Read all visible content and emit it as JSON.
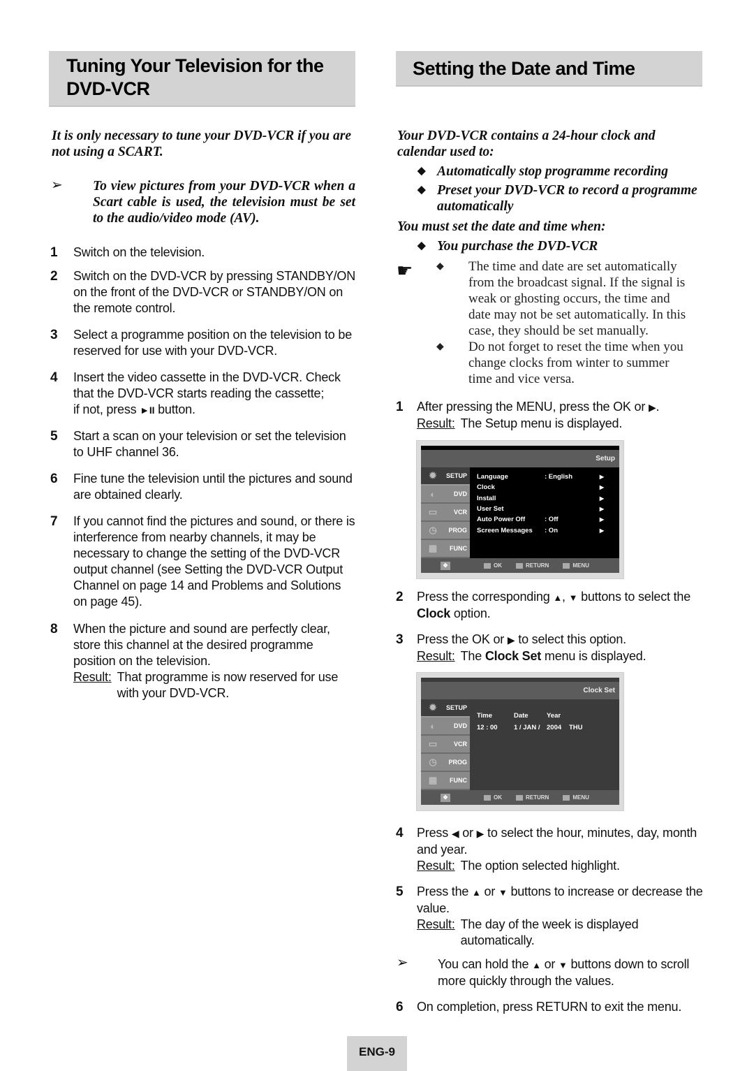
{
  "left": {
    "title_line1": "Tuning Your Television for the",
    "title_line2": "DVD-VCR",
    "intro": "It is only necessary to tune your DVD-VCR if you are not using a SCART.",
    "note_arrow": "➢",
    "note": "To view pictures from your DVD-VCR when a Scart cable is used, the television must be set to the audio/video mode (AV).",
    "steps": [
      {
        "num": "1",
        "text": "Switch on the television."
      },
      {
        "num": "2",
        "text": "Switch on the DVD-VCR by pressing STANDBY/ON on the front of the DVD-VCR or STANDBY/ON on the remote control."
      },
      {
        "num": "3",
        "text": "Select a programme position on the television to be reserved for use with your DVD-VCR."
      },
      {
        "num": "4",
        "text": "Insert the video cassette in the DVD-VCR. Check that the DVD-VCR starts reading the cassette;",
        "text2": "if not, press",
        "icon": "►II",
        "text3": "button."
      },
      {
        "num": "5",
        "text": "Start a scan on your television or set the television to UHF channel 36."
      },
      {
        "num": "6",
        "text": "Fine tune the television until the pictures and sound are obtained clearly."
      },
      {
        "num": "7",
        "text": "If you cannot find the pictures and sound, or there is interference from nearby channels, it may be necessary to change the setting of the DVD-VCR output channel (see Setting the DVD-VCR Output Channel on page 14 and Problems and Solutions on page 45)."
      },
      {
        "num": "8",
        "text": "When the picture and sound are perfectly clear, store this channel at the desired programme position on the television.",
        "result_label": "Result:",
        "result": "That programme is now reserved for use with your DVD-VCR."
      }
    ]
  },
  "right": {
    "title": "Setting the Date and Time",
    "intro": "Your DVD-VCR contains a 24-hour clock and calendar used to:",
    "uses": [
      "Automatically stop programme recording",
      "Preset your DVD-VCR to record a programme automatically"
    ],
    "must_set": "You must set the date and time when:",
    "must_set_items": [
      "You purchase the DVD-VCR"
    ],
    "bullet": "◆",
    "hand_icon": "☛",
    "notes": [
      "The time and date are set automatically from the broadcast signal. If the signal is weak or ghosting occurs, the time and date may not be set automatically. In this case, they should be set manually.",
      "Do not forget to reset the time when you change clocks from winter to summer time and vice versa."
    ],
    "steps": [
      {
        "num": "1",
        "text_a": "After pressing the MENU, press the OK or",
        "icon": "▶",
        "text_b": ".",
        "result_label": "Result:",
        "result": "The Setup menu is displayed."
      },
      {
        "num": "2",
        "text_a": "Press the corresponding",
        "icon_up": "▲",
        "sep": ",",
        "icon_down": "▼",
        "text_b": "buttons to select the",
        "bold": "Clock",
        "text_c": "option."
      },
      {
        "num": "3",
        "text_a": "Press the OK or",
        "icon": "▶",
        "text_b": "to select this option.",
        "result_label": "Result:",
        "result_a": "The",
        "result_bold": "Clock Set",
        "result_b": "menu is displayed."
      },
      {
        "num": "4",
        "text_a": "Press",
        "icon_left": "◀",
        "or": "or",
        "icon_right": "▶",
        "text_b": "to select the hour, minutes, day, month and year.",
        "result_label": "Result:",
        "result": "The option selected highlight."
      },
      {
        "num": "5",
        "text_a": "Press the",
        "icon_up": "▲",
        "or": "or",
        "icon_down": "▼",
        "text_b": "buttons to increase or decrease the value.",
        "result_label": "Result:",
        "result": "The day of the week is displayed automatically."
      },
      {
        "num": "6",
        "text": "On completion, press RETURN to exit the menu."
      }
    ],
    "tip_arrow": "➢",
    "tip_a": "You can hold the",
    "tip_up": "▲",
    "tip_or": "or",
    "tip_down": "▼",
    "tip_b": "buttons down to scroll more quickly through the values."
  },
  "osd_setup": {
    "header": "Setup",
    "sidebar": [
      {
        "label": "SETUP",
        "icon": "gear",
        "active": true
      },
      {
        "label": "DVD",
        "icon": "dvd",
        "active": false
      },
      {
        "label": "VCR",
        "icon": "vcr",
        "active": false
      },
      {
        "label": "PROG",
        "icon": "clock",
        "active": false
      },
      {
        "label": "FUNC",
        "icon": "func",
        "active": false
      }
    ],
    "rows": [
      {
        "key": "Language",
        "value": ": English",
        "arrow": "▶"
      },
      {
        "key": "Clock",
        "value": "",
        "arrow": "▶"
      },
      {
        "key": "Install",
        "value": "",
        "arrow": "▶"
      },
      {
        "key": "User Set",
        "value": "",
        "arrow": "▶"
      },
      {
        "key": "Auto Power Off",
        "value": ": Off",
        "arrow": "▶"
      },
      {
        "key": "Screen Messages",
        "value": ": On",
        "arrow": "▶"
      }
    ],
    "bottom": {
      "ok": "OK",
      "return": "RETURN",
      "menu": "MENU"
    }
  },
  "osd_clock": {
    "header": "Clock Set",
    "headers": [
      "Time",
      "Date",
      "Year",
      ""
    ],
    "values": [
      "12 : 00",
      "1 / JAN /",
      "2004",
      "THU"
    ],
    "bottom": {
      "ok": "OK",
      "return": "RETURN",
      "menu": "MENU"
    }
  },
  "footer": {
    "page": "ENG-9"
  }
}
